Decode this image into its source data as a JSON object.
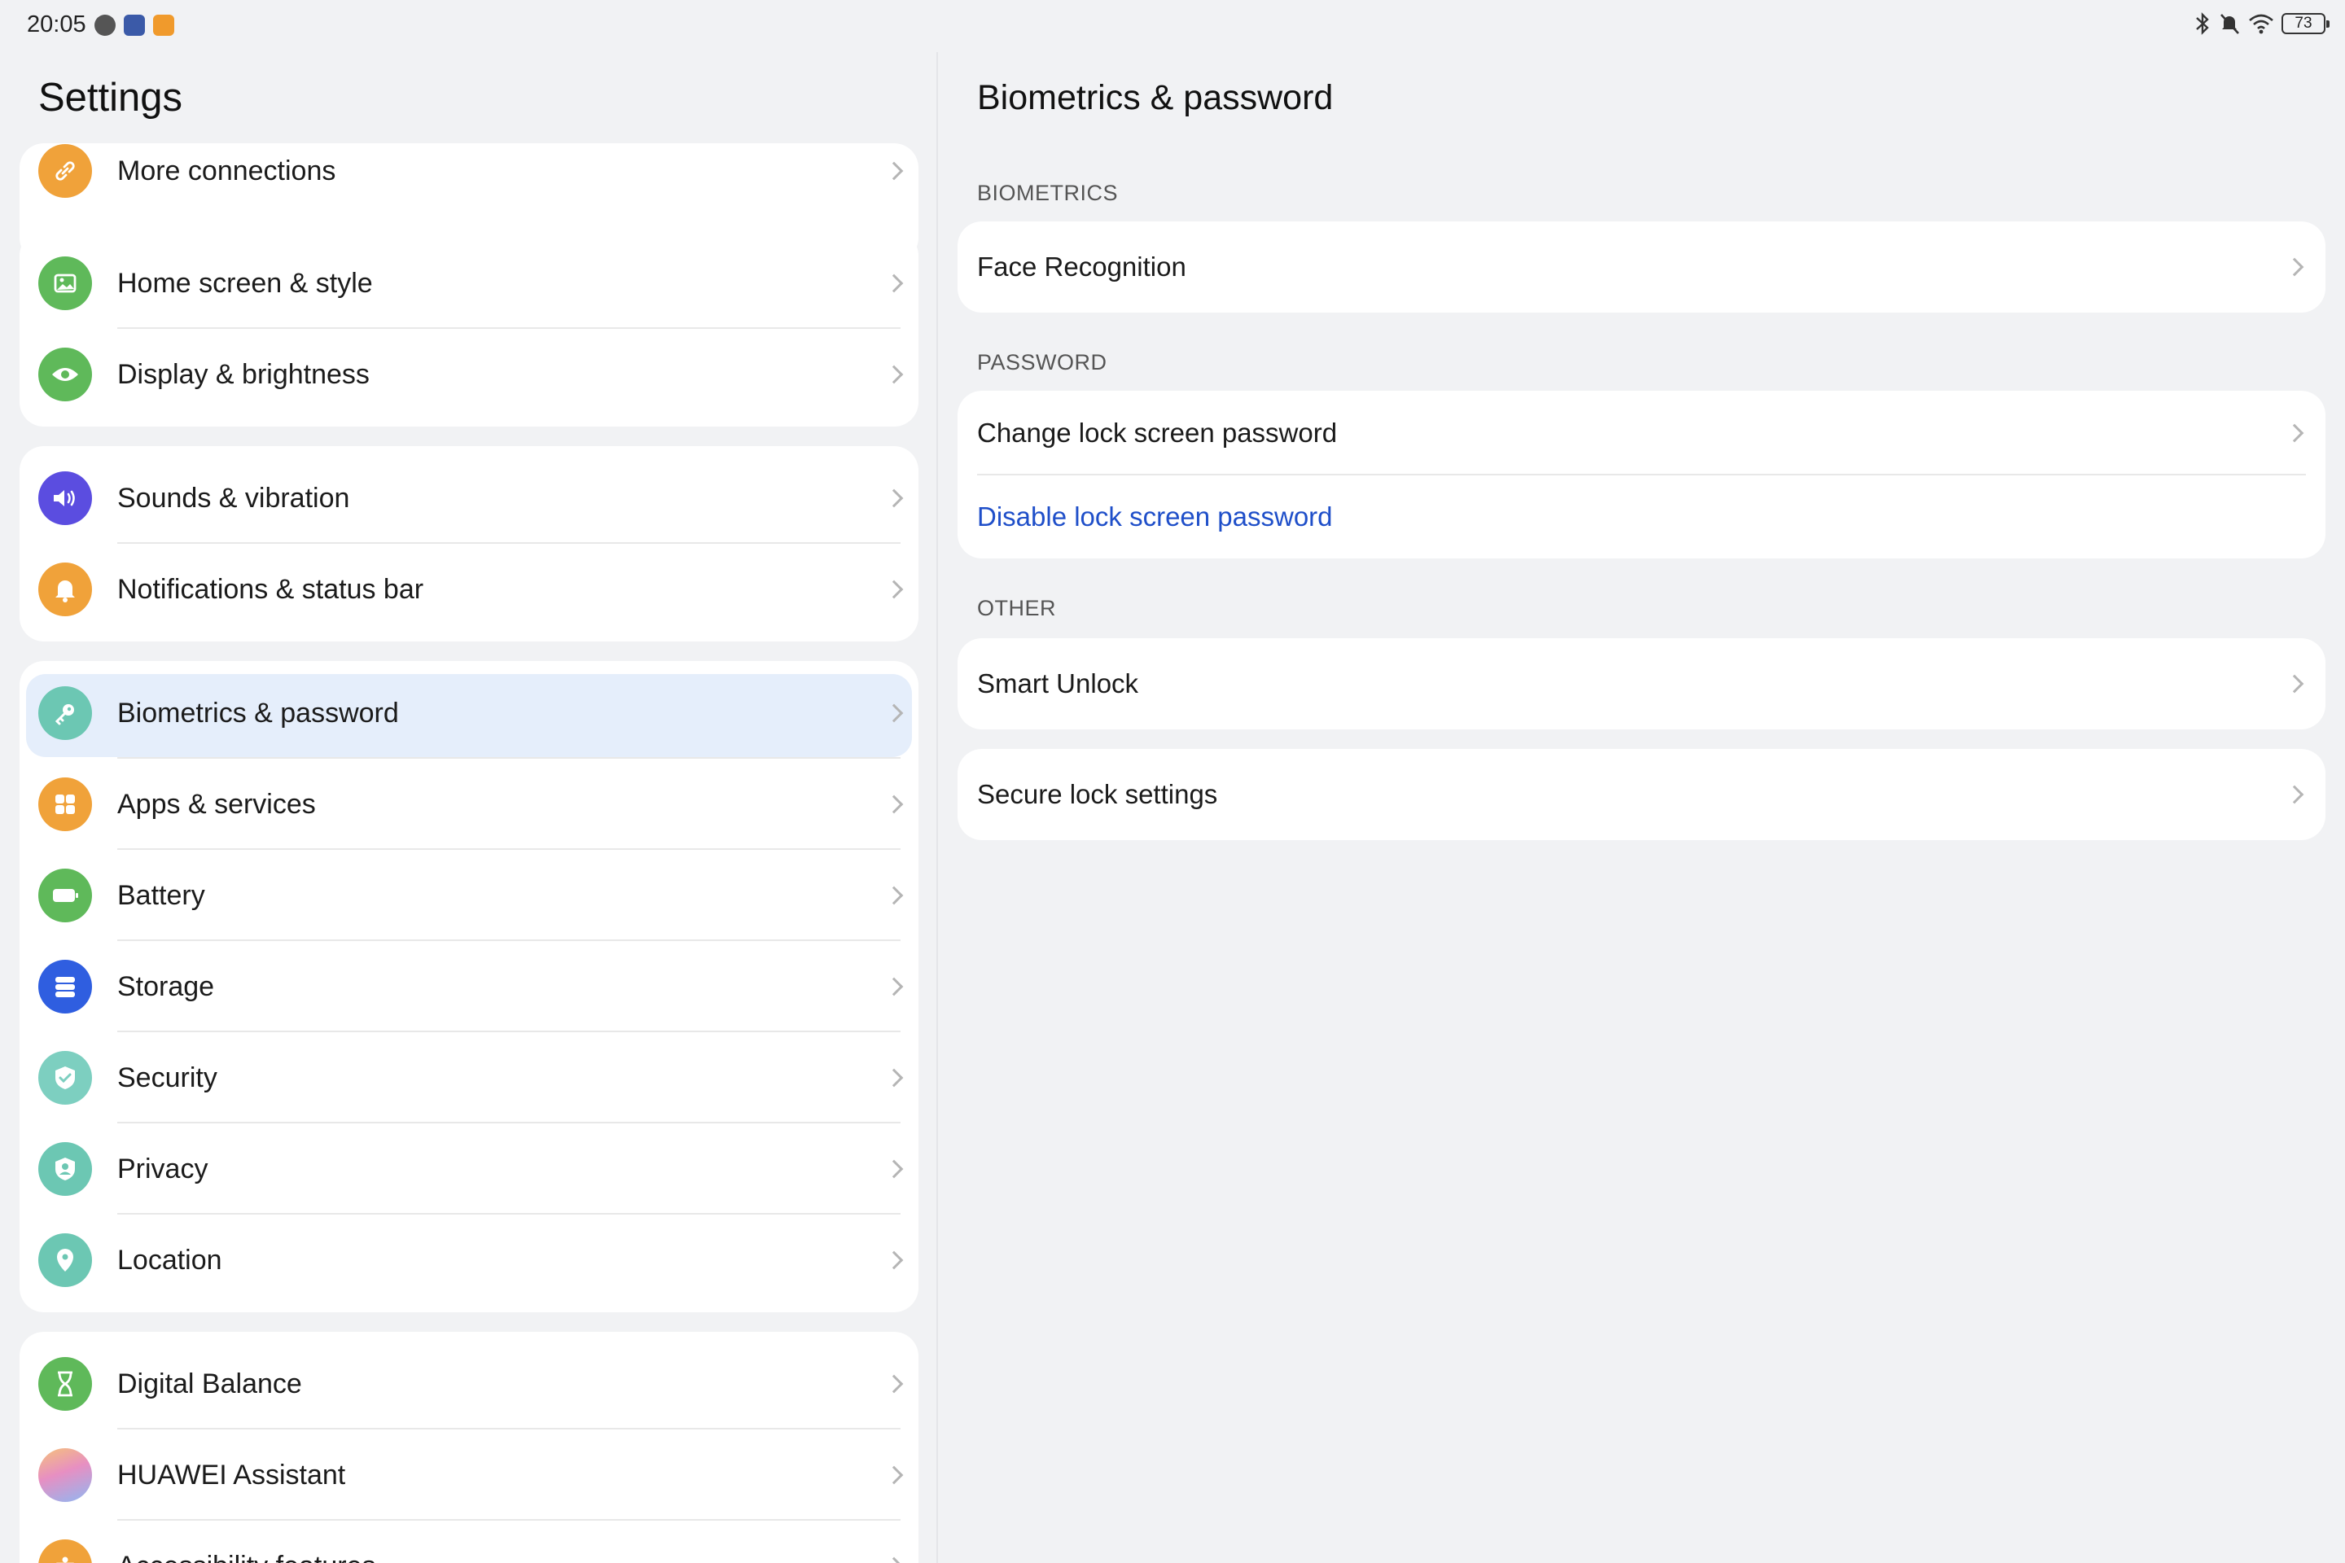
{
  "status_bar": {
    "time": "20:05",
    "battery": "73",
    "icons": [
      "bluetooth-icon",
      "mute-icon",
      "wifi-icon",
      "battery-icon"
    ]
  },
  "left": {
    "title": "Settings",
    "groups": [
      {
        "items": [
          {
            "label": "More connections",
            "icon": "link-icon",
            "color": "#f0a23a"
          }
        ]
      },
      {
        "items": [
          {
            "label": "Home screen & style",
            "icon": "image-icon",
            "color": "#5fb95a"
          },
          {
            "label": "Display & brightness",
            "icon": "eye-icon",
            "color": "#5fb95a"
          }
        ]
      },
      {
        "items": [
          {
            "label": "Sounds & vibration",
            "icon": "speaker-icon",
            "color": "#5b4de0"
          },
          {
            "label": "Notifications & status bar",
            "icon": "bell-icon",
            "color": "#f0a23a"
          }
        ]
      },
      {
        "items": [
          {
            "label": "Biometrics & password",
            "icon": "key-icon",
            "color": "#6cc7b3",
            "selected": true
          },
          {
            "label": "Apps & services",
            "icon": "apps-grid-icon",
            "color": "#f0a23a"
          },
          {
            "label": "Battery",
            "icon": "battery-icon",
            "color": "#5fb95a"
          },
          {
            "label": "Storage",
            "icon": "storage-icon",
            "color": "#2f5ee0"
          },
          {
            "label": "Security",
            "icon": "shield-check-icon",
            "color": "#7dcfc0"
          },
          {
            "label": "Privacy",
            "icon": "privacy-shield-icon",
            "color": "#6cc7b3"
          },
          {
            "label": "Location",
            "icon": "location-pin-icon",
            "color": "#6cc7b3"
          }
        ]
      },
      {
        "items": [
          {
            "label": "Digital Balance",
            "icon": "hourglass-icon",
            "color": "#5fb95a"
          },
          {
            "label": "HUAWEI Assistant",
            "icon": "assistant-icon",
            "color": "#c89be8"
          },
          {
            "label": "Accessibility features",
            "icon": "accessibility-icon",
            "color": "#f0a23a"
          }
        ]
      }
    ]
  },
  "right": {
    "title": "Biometrics & password",
    "sections": {
      "biometrics_label": "BIOMETRICS",
      "password_label": "PASSWORD",
      "other_label": "OTHER"
    },
    "items": {
      "face_recognition": "Face Recognition",
      "change_password": "Change lock screen password",
      "disable_password": "Disable lock screen password",
      "smart_unlock": "Smart Unlock",
      "secure_lock": "Secure lock settings"
    },
    "accent_color": "#1f4fc9"
  }
}
